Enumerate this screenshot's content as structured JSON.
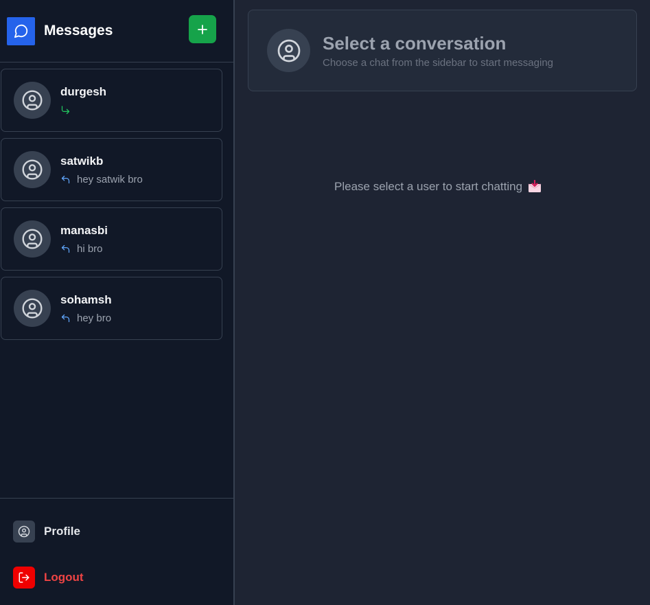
{
  "sidebar": {
    "title": "Messages",
    "new_icon": "plus-icon",
    "conversations": [
      {
        "name": "durgesh",
        "last_message": "",
        "direction": "sent",
        "arrow_color": "#22c55e"
      },
      {
        "name": "satwikb",
        "last_message": "hey satwik bro",
        "direction": "received",
        "arrow_color": "#60a5fa"
      },
      {
        "name": "manasbi",
        "last_message": "hi bro",
        "direction": "received",
        "arrow_color": "#60a5fa"
      },
      {
        "name": "sohamsh",
        "last_message": "hey bro",
        "direction": "received",
        "arrow_color": "#60a5fa"
      }
    ],
    "footer": {
      "profile_label": "Profile",
      "logout_label": "Logout"
    }
  },
  "main": {
    "header_title": "Select a conversation",
    "header_subtitle": "Choose a chat from the sidebar to start messaging",
    "placeholder": "Please select a user to start chatting",
    "placeholder_icon": "incoming-envelope-icon"
  },
  "colors": {
    "brand": "#2563eb",
    "new_button": "#16a34a",
    "logout": "#ef4444"
  }
}
